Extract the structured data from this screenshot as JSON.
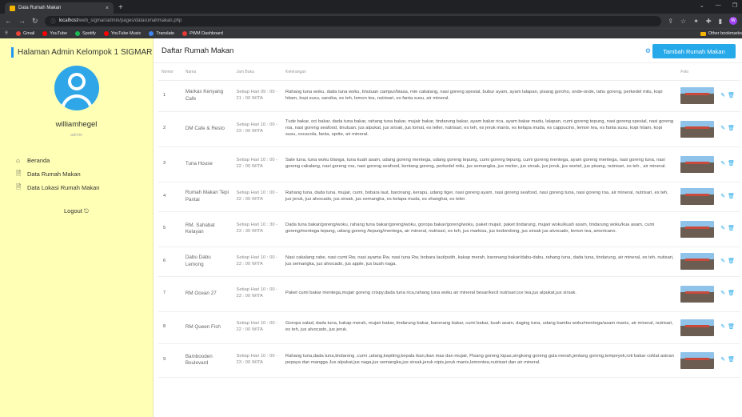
{
  "browser": {
    "tab_title": "Data Rumah Makan",
    "tab_close": "×",
    "new_tab": "+",
    "url_host": "localhost",
    "url_path": "/web_sigmar/admin/pages/datarumahmakan.php",
    "profile_initial": "W",
    "bookmarks": [
      {
        "label": "Gmail",
        "color": "#ea4335"
      },
      {
        "label": "YouTube",
        "color": "#ff0000"
      },
      {
        "label": "Spotify",
        "color": "#1db954"
      },
      {
        "label": "YouTube Music",
        "color": "#ff0000"
      },
      {
        "label": "Translate",
        "color": "#4285f4"
      },
      {
        "label": "PWM Dashboard",
        "color": "#e53935"
      }
    ],
    "other_bookmarks": "Other bookmarks"
  },
  "sidebar": {
    "title": "Halaman Admin Kelompok 1 SIGMAR",
    "username": "williamhegel",
    "role": "admin",
    "menu": [
      {
        "label": "Beranda",
        "icon": "home-icon"
      },
      {
        "label": "Data Rumah Makan",
        "icon": "document-icon"
      },
      {
        "label": "Data Lokasi Rumah Makan",
        "icon": "document-icon"
      }
    ],
    "logout": "Logout"
  },
  "main": {
    "title": "Daftar Rumah Makan",
    "add_button": "Tambah Rumah Makan",
    "columns": [
      "Nomor",
      "Nama",
      "Jam Buka",
      "Keterangan",
      "Foto",
      ""
    ],
    "rows": [
      {
        "no": "1",
        "nama": "Markas Kenyang Cafe",
        "jam": "Setiap Hari 09 : 00 - 21 : 00 WITA",
        "ket": "Rahang tuna woku, dada tuna woku, tinutuan campur/biasa, mie cakalang, nasi goreng spesial, bubur ayam, ayam lalapan, pisang goroho, onde-onde, tahu goreng, perkedel milu, kopi hitam, kopi susu, sarsiba, es teh, lemon tea, nutrisari, es fanta susu, air mineral."
      },
      {
        "no": "2",
        "nama": "DM Cafe & Resto",
        "jam": "Setiap Hari 10 : 00 - 23 : 00 WITA",
        "ket": "Tude bakar, oci bakar, dada tuna bakar, rahang tuna bakar, mujair bakar, tindarung bakar, ayam bakar rica, ayam bakar madu, lalapan, cumi goreng tepung, nasi goreng spesial, nasi goreng roa, nasi goreng seafood, tinutuan, jus alpukat, jus sirsak, jus tomat, es teller, nutrisari, es teh, es jeruk manis, es kelapa muda, es cappucino, lemon tea, es fanta susu, kopi hitam, kopi susu, cocacola, fanta, sprite, air mineral."
      },
      {
        "no": "3",
        "nama": "Tuna House",
        "jam": "Setiap Hari 10 : 00 - 22 : 00 WITA",
        "ket": "Sate tuna, tuna woku blanga, tuna kuah asam, udang goreng mentega, udang goreng tepung, cumi goreng tepung, cumi goreng mentega, ayam goreng mentega, nasi goreng tuna, nasi goreng cakalang, nasi goreng roa, nasi goreng seafood, kentang goreng, perkedel milu, jus semangka, jus melon, jus sirsak, jus jeruk, jus wortel, jus pisang, nutrisari, es teh , air mineral."
      },
      {
        "no": "4",
        "nama": "Rumah Makan Tepi Pantai",
        "jam": "Setiap Hari 10 : 00 - 22 : 00 WITA",
        "ket": "Rahang tuna, dada tuna, mujair, cumi, bobara laut, baronang, kerapu, udang tiger, nasi goreng ayam, nasi goreng seafood, nasi goreng tuna, nasi goreng roa, air mineral, nutrisari, es teh, jus jeruk, jus alvocado, jus sirsak, jus semangka, es kelapa muda, es shanghai, es teler."
      },
      {
        "no": "5",
        "nama": "RM. Sahabat Kelayan",
        "jam": "Setiap Hari 10 : 30 - 23 : 30 WITA",
        "ket": "Dada tuna bakar/goreng/woku, rahang tuna bakar/goreng/woku, goropa bakar/goreng/woku, paket mujair, paket tindarung, mujair woku/kuah asam, tindarung woku/kua asam, cumi goreng/mentega tepung, udang goreng /tepung/mentega, air mineral, nutrisari, es teh, jus markisa, jus kedondong, jus sirsak jus alvocado, lemon tea, americano."
      },
      {
        "no": "6",
        "nama": "Dabu Dabu Lemong",
        "jam": "Setiap Hari 10 : 00 - 23 : 00 WITA",
        "ket": "Nasi cakalang rabe, nasi cumi Rw, nasi ayama Rw, nasi tuna Rw, bobara laut/putih, kakap merah, baronang bakar/dabu-dabu, rahang tuna, dada tuna, tindarung, air mineral, es teh, nutisari, jus semangka, jus alvocado, jus apple, jus buah naga."
      },
      {
        "no": "7",
        "nama": "RM Ocean 27",
        "jam": "Setiap Hari 10 : 00 - 23 : 00 WITA",
        "ket": "Paket cumi bakar mentega,mujair goreng crispy,dada tuna rica,rahang tuna woku air mineral besar/kecil nutrisari,ice tea,jus alpukat,jus sirsak."
      },
      {
        "no": "8",
        "nama": "RM Queen Fish",
        "jam": "Setiap Hari 10 : 00 - 22 : 00 WITA",
        "ket": "Goropa salad, dada tuna, kakap merah, mujair bakar, tindarung bakar, baronang bakar, cumi bakar, kuah asam, daging tuna, udang bambu woku/mentega/asam manis, air mineral, nutrisari, es teh, jus alvocado, jus jeruk."
      },
      {
        "no": "9",
        "nama": "Bambooden Boulevard",
        "jam": "Setiap Hari 10 : 00 - 23 : 00 WITA",
        "ket": "Rahang tuna,dada tuna,tindarong ,cumi ,udang,kepiting,kepala ikan,ikan mas dan mujair, Pisang goreng kipas,singkong goreng gula merah,jentang goreng,tempeyek,roti bakar coklat asinan pepaya dan mangga Jus alpukat,jus naga,jus semangka,jus sirsak,jeruk nipis,jeruk manis,lemonteа,nutrisari dan air mineral."
      }
    ]
  }
}
